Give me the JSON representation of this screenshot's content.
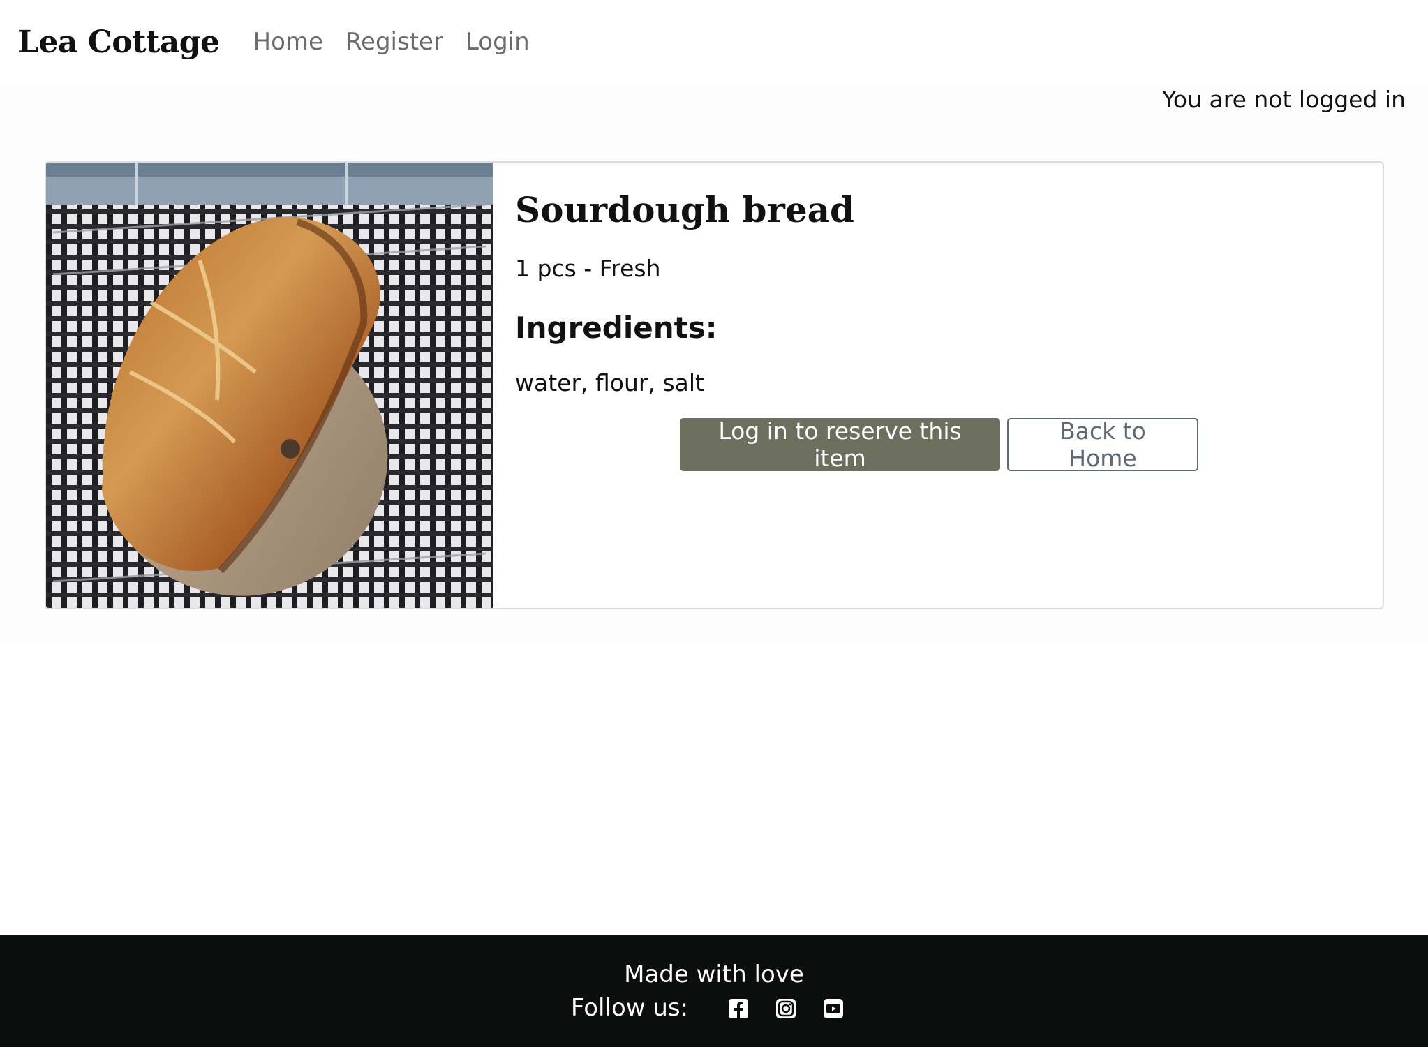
{
  "navbar": {
    "brand": "Lea Cottage",
    "links": [
      "Home",
      "Register",
      "Login"
    ]
  },
  "status": {
    "login_text": "You are not logged in"
  },
  "product": {
    "title": "Sourdough bread",
    "meta": "1 pcs - Fresh",
    "ingredients_heading": "Ingredients:",
    "ingredients": "water, flour, salt",
    "reserve_button": "Log in to reserve this item",
    "back_button": "Back to Home"
  },
  "footer": {
    "tagline": "Made with love",
    "follow_label": "Follow us:",
    "social_icons": [
      "facebook-icon",
      "instagram-icon",
      "youtube-icon"
    ]
  },
  "colors": {
    "primary_button": "#6c6e5e",
    "outline_button": "#5f6a74",
    "footer_bg": "#0c0e0d",
    "nav_link": "#6b6b6b"
  }
}
